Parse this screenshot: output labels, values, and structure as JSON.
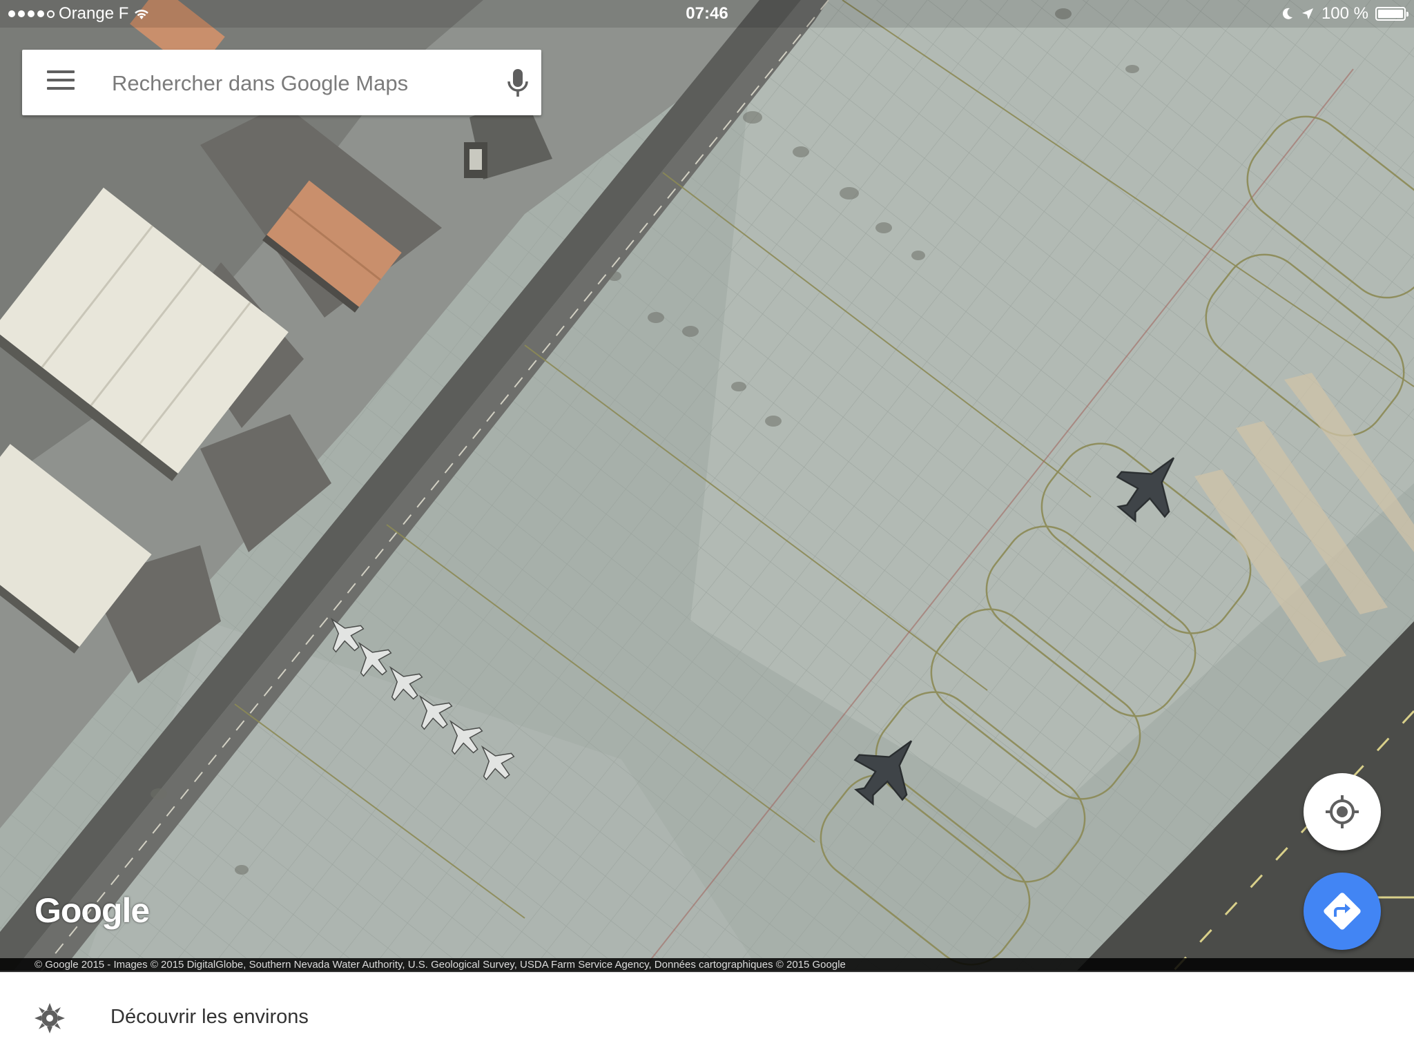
{
  "status_bar": {
    "carrier": "Orange F",
    "time": "07:46",
    "battery": "100 %",
    "signal_icon": "signal-dots-icon",
    "wifi_icon": "wifi-icon",
    "moon_icon": "do-not-disturb-moon-icon",
    "location_icon": "location-arrow-icon",
    "battery_icon": "battery-icon"
  },
  "search": {
    "placeholder": "Rechercher dans Google Maps",
    "menu_icon": "hamburger-menu-icon",
    "mic_icon": "microphone-icon"
  },
  "map": {
    "logo": "Google",
    "attribution": "© Google 2015 - Images © 2015 DigitalGlobe, Southern Nevada Water Authority, U.S. Geological Survey, USDA Farm Service Agency, Données cartographiques © 2015 Google",
    "my_location_icon": "my-location-crosshair-icon",
    "directions_icon": "directions-arrow-icon"
  },
  "bottom_bar": {
    "label": "Découvrir les environs",
    "icon": "explore-gear-icon"
  },
  "colors": {
    "fab_blue": "#4285f4",
    "apron": "#a9b2ac",
    "taxiway_line": "#8c8a55"
  }
}
